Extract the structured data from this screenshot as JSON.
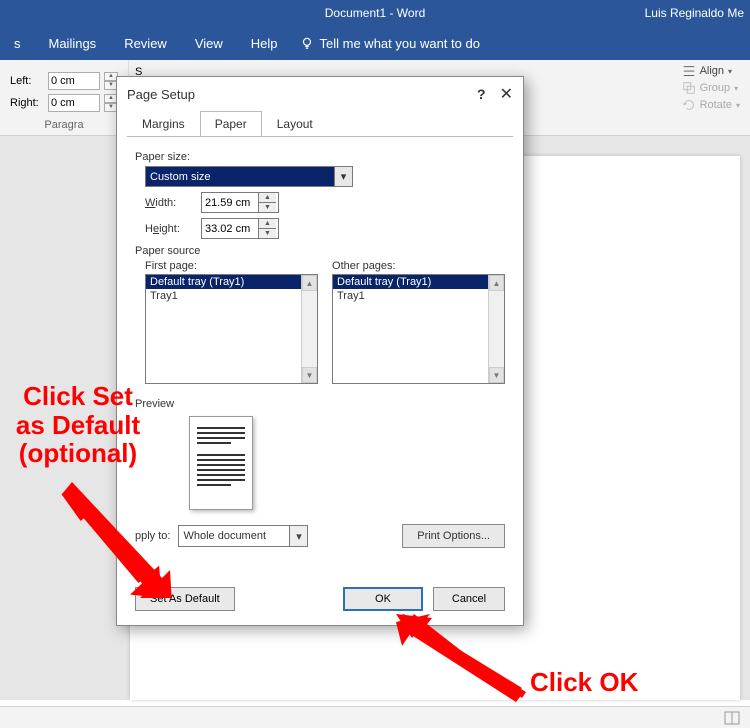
{
  "title": {
    "document": "Document1  -  Word",
    "user": "Luis Reginaldo Me"
  },
  "menu": {
    "items": [
      "s",
      "Mailings",
      "Review",
      "View",
      "Help"
    ],
    "tellme": "Tell me what you want to do"
  },
  "ribbon": {
    "left_label": "Left:",
    "right_label": "Right:",
    "left_value": "0 cm",
    "right_value": "0 cm",
    "group_label": "Paragra",
    "sp_label": "S",
    "arrange": {
      "align": "Align",
      "group": "Group",
      "rotate": "Rotate"
    }
  },
  "dialog": {
    "title": "Page Setup",
    "help": "?",
    "close": "✕",
    "tabs": {
      "margins": "Margins",
      "paper": "Paper",
      "layout": "Layout"
    },
    "paper_size_label": "Paper size:",
    "paper_size_value": "Custom size",
    "width_label": "Width:",
    "width_value": "21.59 cm",
    "height_label": "Height:",
    "height_value": "33.02 cm",
    "paper_source_label": "Paper source",
    "first_page_label": "First page:",
    "other_pages_label": "Other pages:",
    "tray_options": {
      "default": "Default tray (Tray1)",
      "tray1": "Tray1"
    },
    "preview_label": "Preview",
    "apply_to_label": "pply to:",
    "apply_to_value": "Whole document",
    "print_options": "Print Options...",
    "set_default": "Set As Default",
    "ok": "OK",
    "cancel": "Cancel"
  },
  "annotations": {
    "set_default": "Click Set\nas Default\n(optional)",
    "click_ok": "Click OK"
  }
}
